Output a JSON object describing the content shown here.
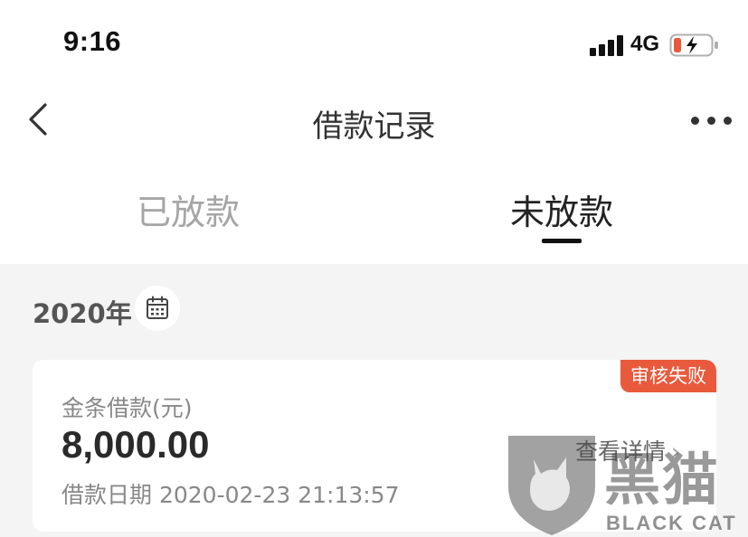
{
  "status_bar": {
    "time": "9:16",
    "network": "4G",
    "icons": [
      "signal-icon",
      "battery-charging-icon"
    ],
    "battery_color": "#e95a3c"
  },
  "nav": {
    "title": "借款记录",
    "back_icon": "chevron-left-icon",
    "more_icon": "more-horizontal-icon"
  },
  "tabs": [
    {
      "label": "已放款",
      "active": false
    },
    {
      "label": "未放款",
      "active": true
    }
  ],
  "year_section": {
    "year": "2020年",
    "calendar_icon": "calendar-icon"
  },
  "record": {
    "product_label": "金条借款(元)",
    "amount": "8,000.00",
    "date_label": "借款日期",
    "date_value": "2020-02-23 21:13:57",
    "status": "审核失败",
    "status_color": "#e95a3c",
    "detail_label": "查看详情",
    "detail_icon": "chevron-right-icon"
  },
  "watermark": {
    "text": "黑猫",
    "sub": "BLACK CAT"
  },
  "colors": {
    "page_background": "#f4f4f4",
    "card_background": "#ffffff",
    "active_tab": "#222222",
    "inactive_tab": "#a5a5a5"
  }
}
